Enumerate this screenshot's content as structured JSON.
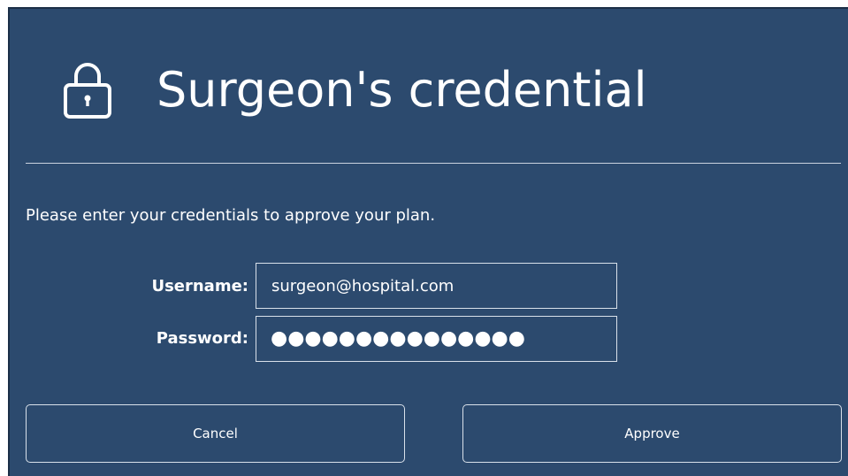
{
  "dialog": {
    "title": "Surgeon's credential",
    "icon": "lock-icon",
    "instructions": "Please enter your credentials to approve your plan."
  },
  "form": {
    "username_label": "Username:",
    "username_value": "surgeon@hospital.com",
    "password_label": "Password:",
    "password_masked": "●●●●●●●●●●●●●●●"
  },
  "buttons": {
    "cancel_label": "Cancel",
    "approve_label": "Approve"
  },
  "colors": {
    "background": "#2c4a6e",
    "text": "#ffffff",
    "border": "#d9e1ea"
  }
}
